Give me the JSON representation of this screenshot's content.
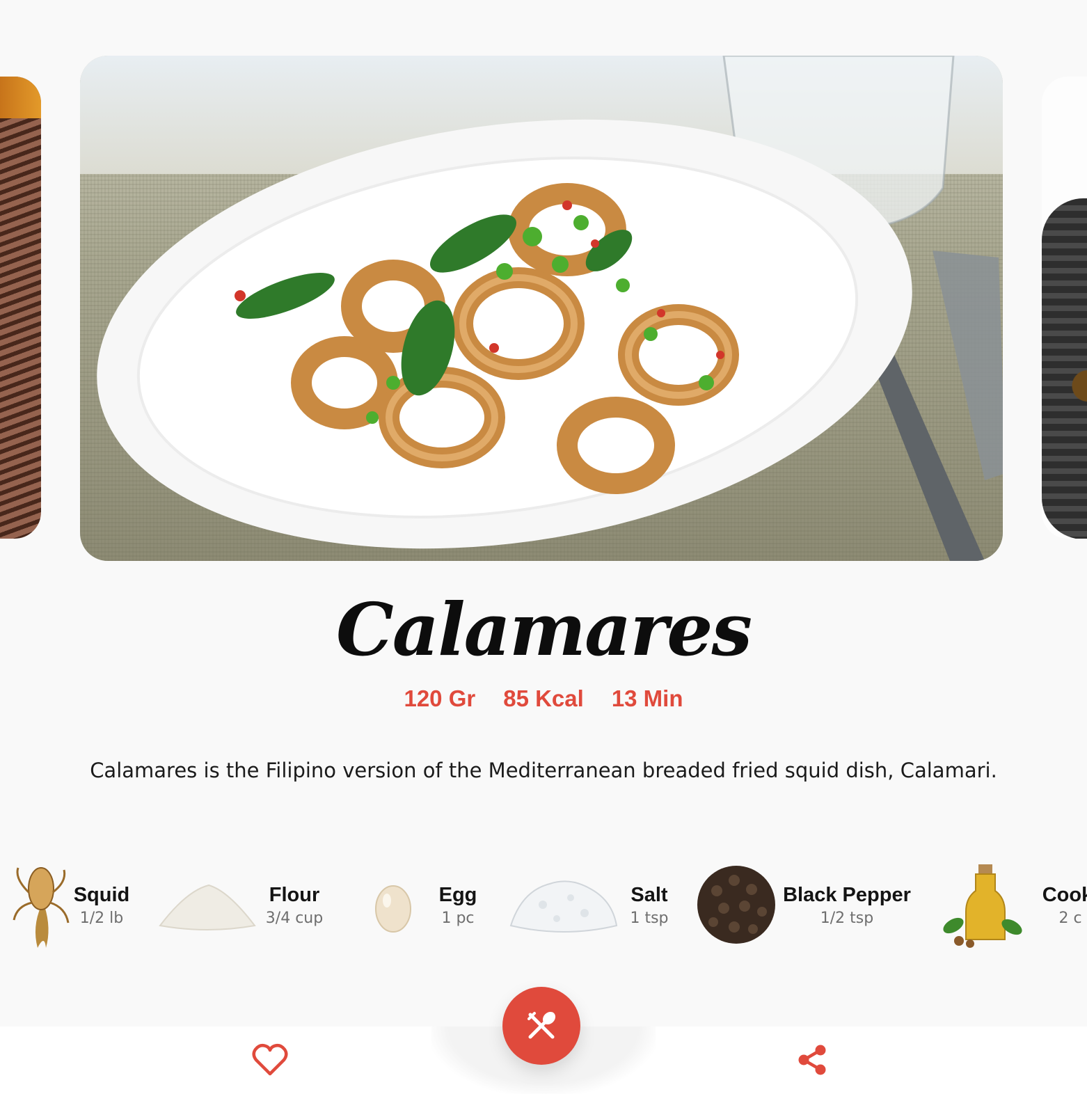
{
  "recipe": {
    "title": "Calamares",
    "stats": {
      "weight": "120 Gr",
      "calories": "85 Kcal",
      "time": "13 Min"
    },
    "description": "Calamares is the Filipino version of the Mediterranean breaded fried squid dish, Calamari."
  },
  "ingredients": [
    {
      "name": "Squid",
      "qty": "1/2 lb",
      "icon": "squid-icon"
    },
    {
      "name": "Flour",
      "qty": "3/4 cup",
      "icon": "flour-icon"
    },
    {
      "name": "Egg",
      "qty": "1 pc",
      "icon": "egg-icon"
    },
    {
      "name": "Salt",
      "qty": "1 tsp",
      "icon": "salt-icon"
    },
    {
      "name": "Black Pepper",
      "qty": "1/2 tsp",
      "icon": "black-pepper-icon"
    },
    {
      "name": "Cooki",
      "qty": "2 c",
      "icon": "cooking-oil-icon"
    }
  ],
  "bottom_nav": {
    "favorite_icon": "heart-icon",
    "cook_icon": "fork-spoon-icon",
    "share_icon": "share-icon"
  },
  "colors": {
    "accent": "#e04a3c",
    "background": "#f9f9f9",
    "text": "#141414",
    "muted": "#6e6e6e"
  }
}
